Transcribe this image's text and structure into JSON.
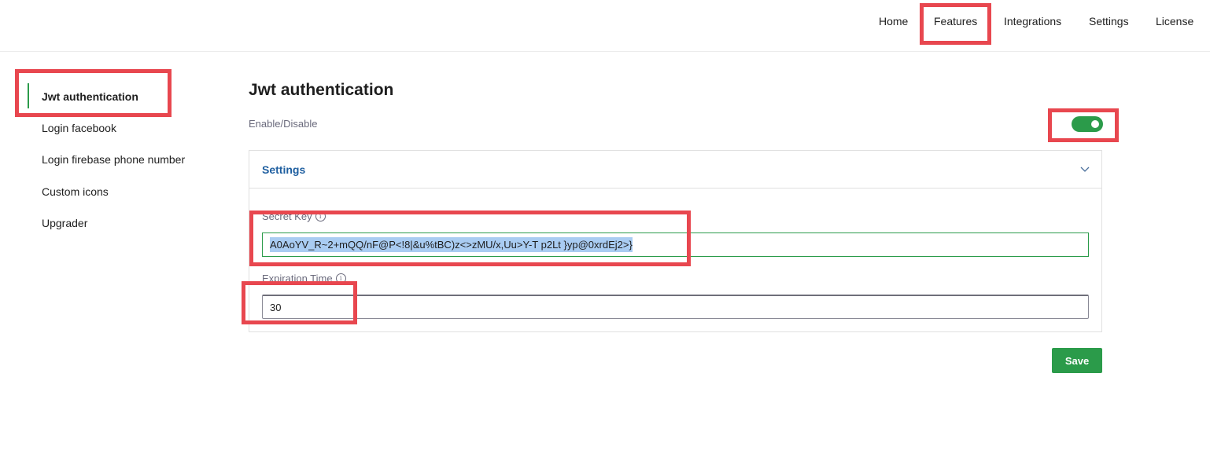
{
  "nav": {
    "home": "Home",
    "features": "Features",
    "integrations": "Integrations",
    "settings": "Settings",
    "license": "License"
  },
  "sidebar": {
    "items": [
      {
        "label": "Jwt authentication",
        "active": true
      },
      {
        "label": "Login facebook"
      },
      {
        "label": "Login firebase phone number"
      },
      {
        "label": "Custom icons"
      },
      {
        "label": "Upgrader"
      }
    ]
  },
  "main": {
    "title": "Jwt authentication",
    "enable_label": "Enable/Disable",
    "enabled": true,
    "panel_title": "Settings",
    "secret_key_label": "Secret Key",
    "secret_key_value": "A0AoYV_R~2+mQQ/nF@P<!8|&u%tBC)z<>zMU/x,Uu>Y-T p2Lt }yp@0xrdEj2>}",
    "expiration_label": "Expiration Time",
    "expiration_value": "30",
    "save_label": "Save"
  },
  "colors": {
    "accent_green": "#2b9b4a",
    "link_blue": "#1f5fa0",
    "annotation_red": "#e8474f",
    "selection_blue": "#a9ccf2"
  },
  "icons": {
    "info": "info-icon",
    "chevron": "chevron-down-icon"
  }
}
